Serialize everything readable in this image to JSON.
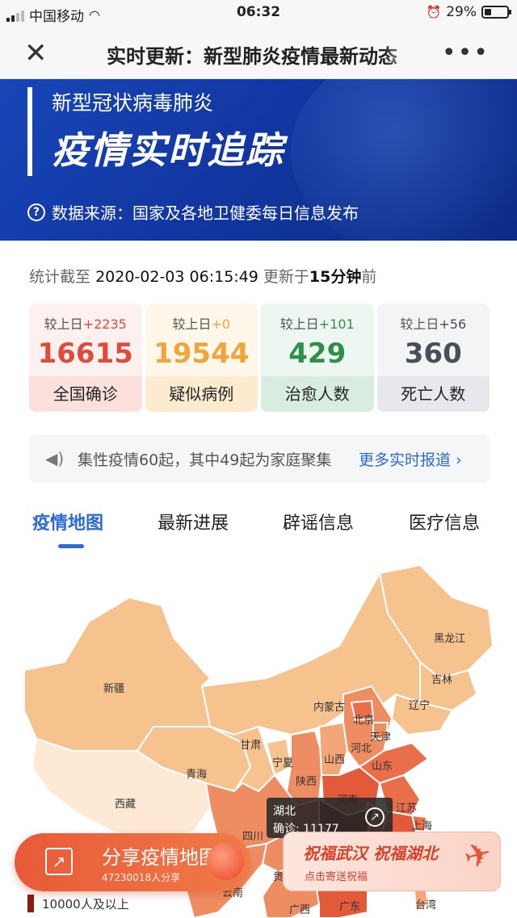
{
  "status_bar": {
    "carrier": "中国移动",
    "time": "06:32",
    "battery": "29%",
    "battery_level": 0.29
  },
  "nav": {
    "title": "实时更新：新型肺炎疫情最新动态",
    "close_glyph": "✕",
    "more_glyph": "•••"
  },
  "banner": {
    "subtitle": "新型冠状病毒肺炎",
    "title": "疫情实时追踪",
    "source": "数据来源：国家及各地卫健委每日信息发布"
  },
  "summary": {
    "prefix": "统计截至",
    "timestamp": "2020-02-03 06:15:49",
    "updated_prefix": "更新于",
    "updated_ago": "15分钟",
    "updated_suffix": "前"
  },
  "stats": [
    {
      "delta_label": "较上日",
      "delta": "+2235",
      "value": "16615",
      "label": "全国确诊",
      "color": "#e04a3b"
    },
    {
      "delta_label": "较上日",
      "delta": "+0",
      "value": "19544",
      "label": "疑似病例",
      "color": "#f2a43a"
    },
    {
      "delta_label": "较上日",
      "delta": "+101",
      "value": "429",
      "label": "治愈人数",
      "color": "#2f8f4a"
    },
    {
      "delta_label": "较上日",
      "delta": "+56",
      "value": "360",
      "label": "死亡人数",
      "color": "#4a4f57"
    }
  ],
  "ticker": {
    "text": "集性疫情60起，其中49起为家庭聚集",
    "more": "更多实时报道 ›"
  },
  "tabs": [
    {
      "label": "疫情地图",
      "active": true
    },
    {
      "label": "最新进展",
      "active": false
    },
    {
      "label": "辟谣信息",
      "active": false
    },
    {
      "label": "医疗信息",
      "active": false
    }
  ],
  "map": {
    "provinces": [
      "黑龙江",
      "吉林",
      "辽宁",
      "新疆",
      "内蒙古",
      "北京",
      "天津",
      "河北",
      "山西",
      "山东",
      "甘肃",
      "宁夏",
      "青海",
      "陕西",
      "河南",
      "江苏",
      "上海",
      "西藏",
      "四川",
      "湖北",
      "贵州",
      "广西",
      "广东",
      "台湾",
      "云南"
    ],
    "tooltip": {
      "province": "湖北",
      "label": "确诊:",
      "value": "11177"
    }
  },
  "share": {
    "title": "分享疫情地图",
    "count": "47230018人分享"
  },
  "bless": {
    "title": "祝福武汉 祝福湖北",
    "cta": "点击寄送祝福"
  },
  "legend": {
    "label": "10000人及以上",
    "color": "#8b1c12"
  }
}
